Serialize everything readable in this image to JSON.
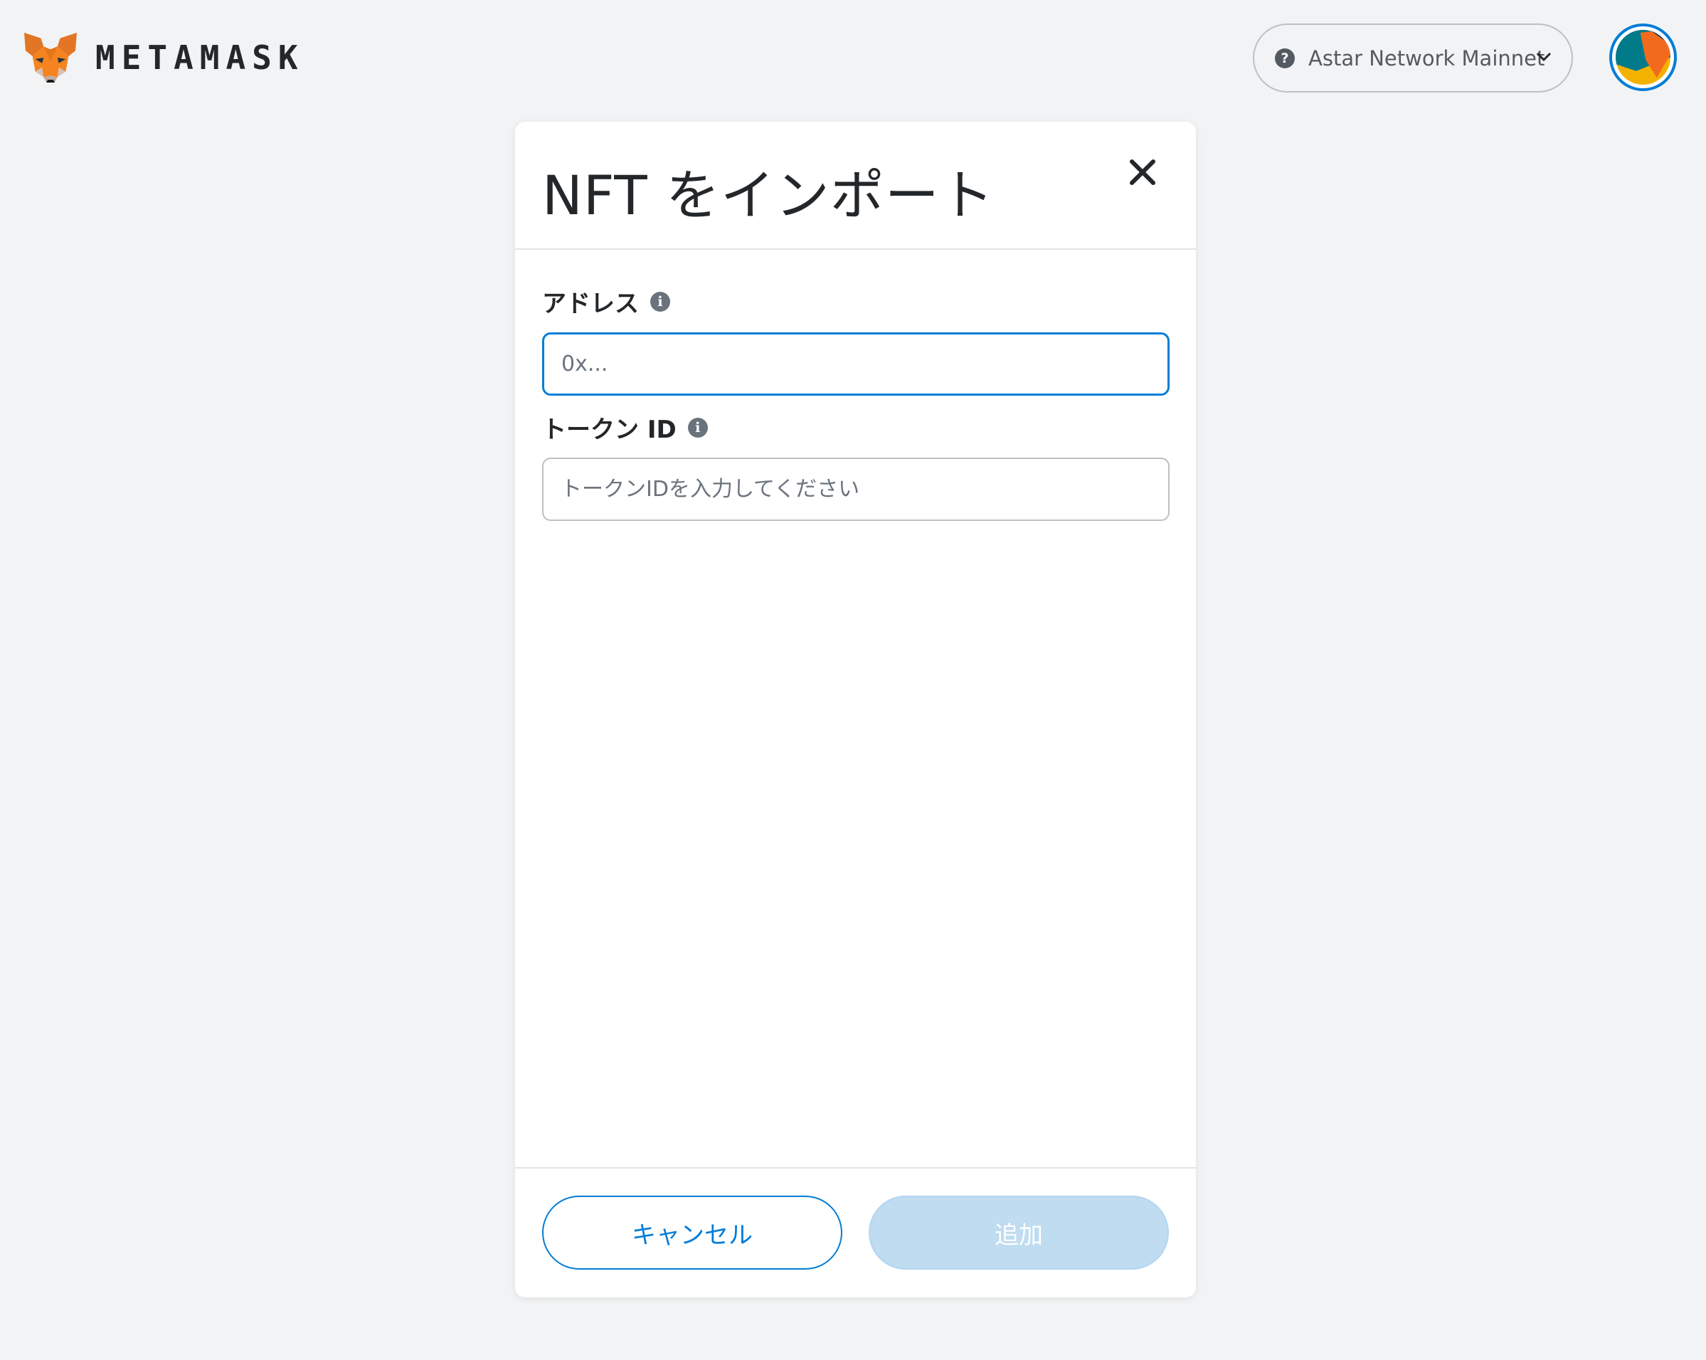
{
  "header": {
    "brand": "METAMASK",
    "network": {
      "name": "Astar Network Mainnet",
      "status_icon": "question-mark-icon"
    },
    "avatar": {
      "colors": [
        "#f26b1d",
        "#017a8a",
        "#f4b200",
        "#0f3b6e"
      ]
    }
  },
  "modal": {
    "title": "NFT をインポート",
    "fields": {
      "address": {
        "label": "アドレス",
        "value": "",
        "placeholder": "0x..."
      },
      "token_id": {
        "label": "トークン ID",
        "value": "",
        "placeholder": "トークンIDを入力してください"
      }
    },
    "buttons": {
      "cancel": "キャンセル",
      "add": "追加"
    }
  },
  "colors": {
    "accent": "#037dd6",
    "disabled_button": "#bfdcf0",
    "background": "#f2f3f4"
  }
}
